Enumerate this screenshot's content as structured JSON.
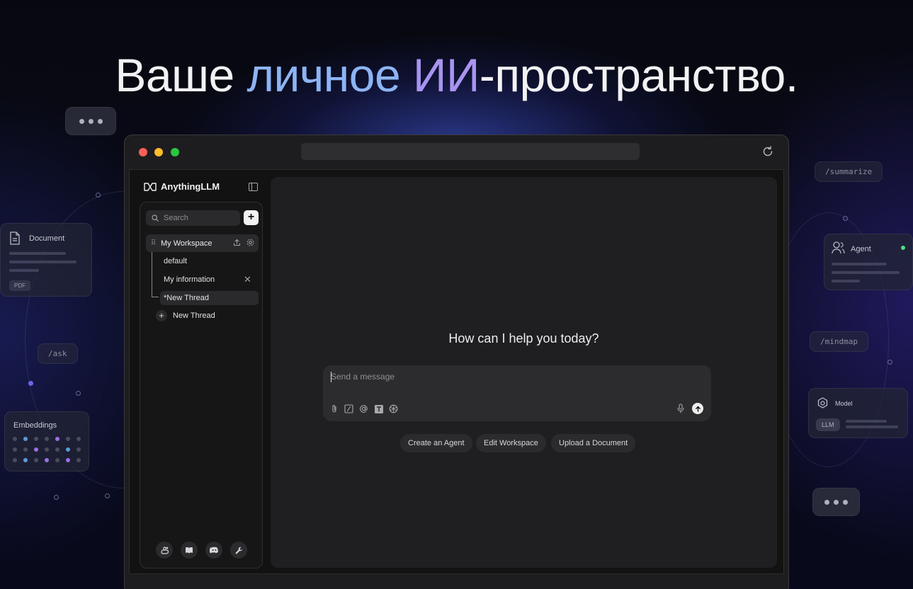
{
  "headline": {
    "part1": "Ваше ",
    "accent1": "личное ",
    "accent2": "ИИ",
    "part2": "-пространство."
  },
  "background": {
    "document_card": {
      "label": "Document",
      "tag": "PDF"
    },
    "embeddings_card": {
      "label": "Embeddings"
    },
    "agent_card": {
      "label": "Agent",
      "status_color": "#4ade80"
    },
    "model_card": {
      "label": "Model",
      "tag": "LLM"
    },
    "commands": [
      "/ask",
      "/summarize",
      "/mindmap"
    ]
  },
  "app": {
    "brand": "AnythingLLM",
    "search_placeholder": "Search",
    "workspace": {
      "name": "My Workspace"
    },
    "threads": [
      {
        "label": "default"
      },
      {
        "label": "My information"
      },
      {
        "label": "*New Thread"
      }
    ],
    "new_thread_label": "New Thread",
    "greeting": "How can I help you today?",
    "composer_placeholder": "Send a message",
    "quick_actions": [
      "Create an Agent",
      "Edit Workspace",
      "Upload a Document"
    ]
  },
  "colors": {
    "accent_blue": "#8db4f4",
    "accent_purple": "#a894f0",
    "close": "#ff5f57",
    "minimize": "#febc2e",
    "zoom": "#28c840"
  }
}
